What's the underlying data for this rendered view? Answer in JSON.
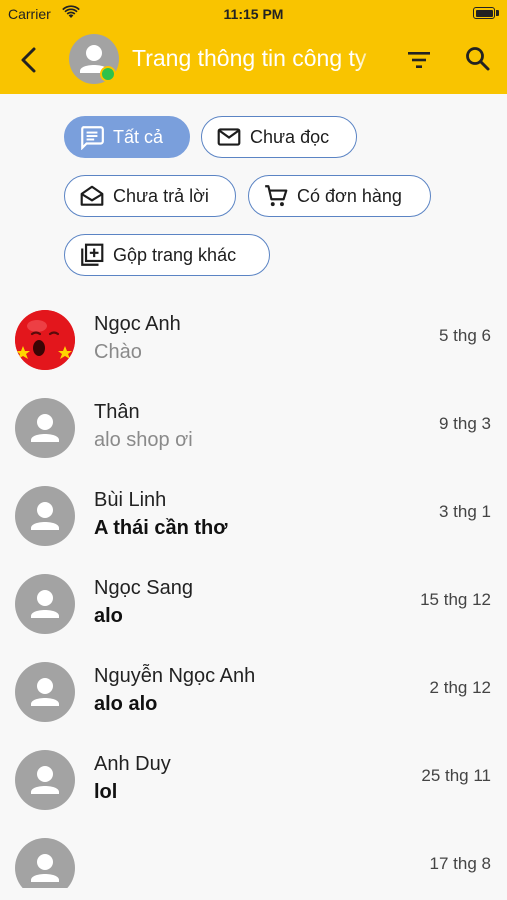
{
  "status_bar": {
    "carrier": "Carrier",
    "time": "11:15 PM"
  },
  "header": {
    "title": "Trang thông tin công ty",
    "background_color": "#f9c400",
    "online_color": "#2fc24a"
  },
  "filters": [
    {
      "label": "Tất cả",
      "icon": "message-icon",
      "active": true
    },
    {
      "label": "Chưa đọc",
      "icon": "mail-icon",
      "active": false
    },
    {
      "label": "Chưa trả lời",
      "icon": "open-mail-icon",
      "active": false
    },
    {
      "label": "Có đơn hàng",
      "icon": "cart-icon",
      "active": false
    },
    {
      "label": "Gộp trang khác",
      "icon": "add-box-icon",
      "active": false
    }
  ],
  "conversations": [
    {
      "name": "Ngọc Anh",
      "message": "Chào",
      "date": "5 thg 6",
      "unread": false,
      "avatar": "emoji-avatar"
    },
    {
      "name": "Thân",
      "message": "alo shop ơi",
      "date": "9 thg 3",
      "unread": false,
      "avatar": "person-icon"
    },
    {
      "name": "Bùi Linh",
      "message": "A thái cần thơ",
      "date": "3 thg 1",
      "unread": true,
      "avatar": "person-icon"
    },
    {
      "name": "Ngọc Sang",
      "message": "alo",
      "date": "15 thg 12",
      "unread": true,
      "avatar": "person-icon"
    },
    {
      "name": "Nguyễn Ngọc Anh",
      "message": "alo alo",
      "date": "2 thg 12",
      "unread": true,
      "avatar": "person-icon"
    },
    {
      "name": "Anh Duy",
      "message": "lol",
      "date": "25 thg 11",
      "unread": true,
      "avatar": "person-icon"
    },
    {
      "name": "",
      "message": "",
      "date": "17 thg 8",
      "unread": false,
      "avatar": "person-icon"
    }
  ],
  "colors": {
    "chip_border": "#5b84c4",
    "chip_active": "#7a9fdc",
    "avatar_gray": "#a3a3a3"
  }
}
